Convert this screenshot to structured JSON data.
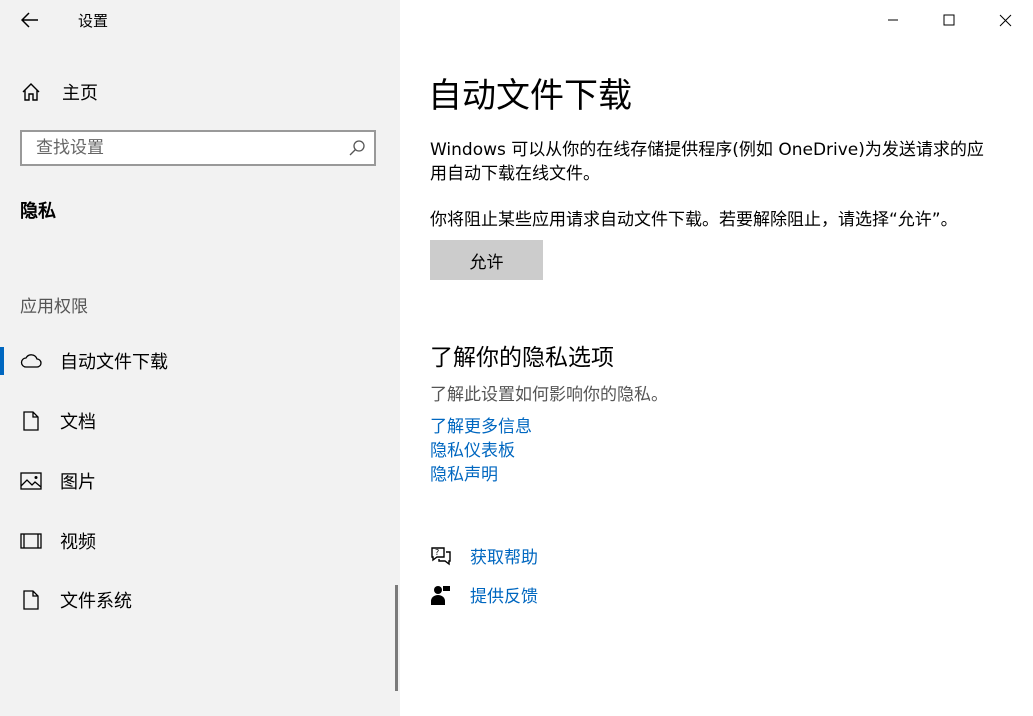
{
  "window": {
    "app_title": "设置",
    "controls": [
      "minimize",
      "maximize",
      "close"
    ]
  },
  "sidebar": {
    "home_label": "主页",
    "search_placeholder": "查找设置",
    "section_title": "隐私",
    "group_title": "应用权限",
    "items": [
      {
        "label": "自动文件下载",
        "icon": "cloud-icon",
        "selected": true
      },
      {
        "label": "文档",
        "icon": "document-icon",
        "selected": false
      },
      {
        "label": "图片",
        "icon": "picture-icon",
        "selected": false
      },
      {
        "label": "视频",
        "icon": "video-icon",
        "selected": false
      },
      {
        "label": "文件系统",
        "icon": "file-icon",
        "selected": false
      }
    ]
  },
  "main": {
    "title": "自动文件下载",
    "description": "Windows 可以从你的在线存储提供程序(例如 OneDrive)为发送请求的应用自动下载在线文件。",
    "blocked_text": "你将阻止某些应用请求自动文件下载。若要解除阻止，请选择“允许”。",
    "allow_button": "允许",
    "privacy_title": "了解你的隐私选项",
    "privacy_desc": "了解此设置如何影响你的隐私。",
    "links": [
      "了解更多信息",
      "隐私仪表板",
      "隐私声明"
    ],
    "help": {
      "get_help": "获取帮助",
      "feedback": "提供反馈"
    }
  },
  "colors": {
    "accent": "#0067c0",
    "sidebar_bg": "#f2f2f2",
    "button_bg": "#cccccc"
  }
}
